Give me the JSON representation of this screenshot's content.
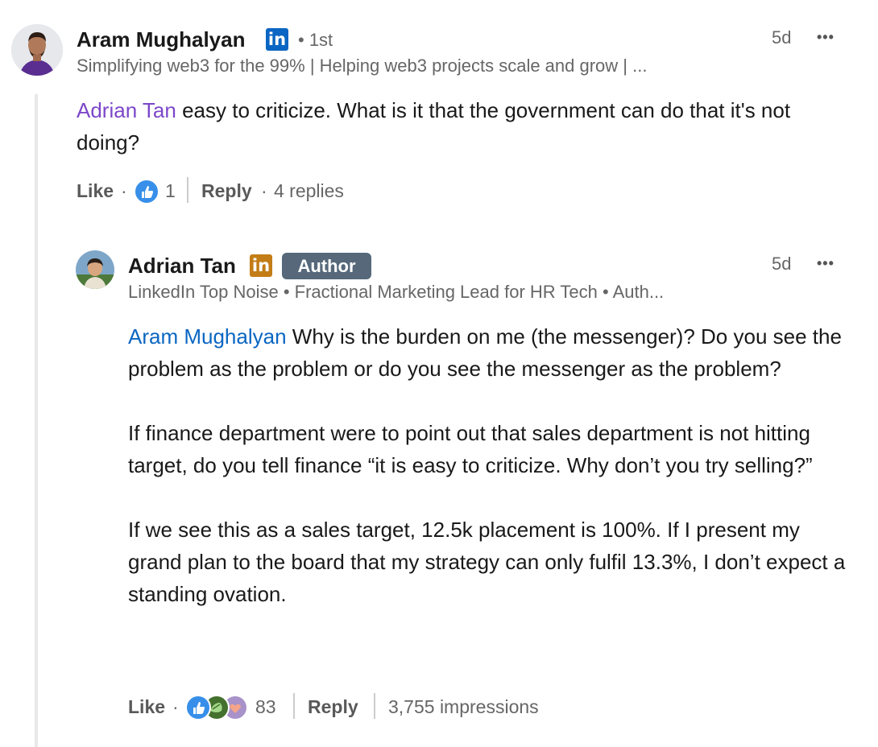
{
  "comment": {
    "author": {
      "name": "Aram Mughalyan",
      "degree": "• 1st",
      "headline": "Simplifying web3 for the 99% | Helping web3 projects scale and grow | ...",
      "brand_badge": "in",
      "brand_color": "#0a66c2"
    },
    "timestamp": "5d",
    "more_label": "•••",
    "mention": "Adrian Tan",
    "mention_color": "#7c47c9",
    "text": "easy to criticize. What is it that the government can do that it's not doing?",
    "actions": {
      "like_label": "Like",
      "sep1": "·",
      "reaction_icon": "like-icon",
      "reaction_count": "1",
      "reply_label": "Reply",
      "sep2": "·",
      "replies_text": "4 replies"
    }
  },
  "reply": {
    "author": {
      "name": "Adrian Tan",
      "brand_badge": "in",
      "brand_color": "#c37d16",
      "author_tag": "Author",
      "headline": "LinkedIn Top Noise • Fractional Marketing Lead for HR Tech • Auth..."
    },
    "timestamp": "5d",
    "more_label": "•••",
    "mention": "Aram Mughalyan",
    "mention_color": "#0a66c2",
    "paragraph1_rest": "Why is the burden on me (the messenger)? Do you see the problem as the problem or do you see the messenger as the problem?",
    "paragraph2": "If finance department were to point out that sales department is not hitting target, do you tell finance “it is easy to criticize. Why don’t you try selling?”",
    "paragraph3": "If we see this as a sales target, 12.5k placement is 100%. If I present my grand plan to the board that my strategy can only fulfil 13.3%, I don’t expect a standing ovation.",
    "actions": {
      "like_label": "Like",
      "sep1": "·",
      "reaction_icons": [
        "like-icon",
        "support-icon",
        "love-icon"
      ],
      "reaction_count": "83",
      "reply_label": "Reply",
      "impressions": "3,755 impressions"
    }
  }
}
